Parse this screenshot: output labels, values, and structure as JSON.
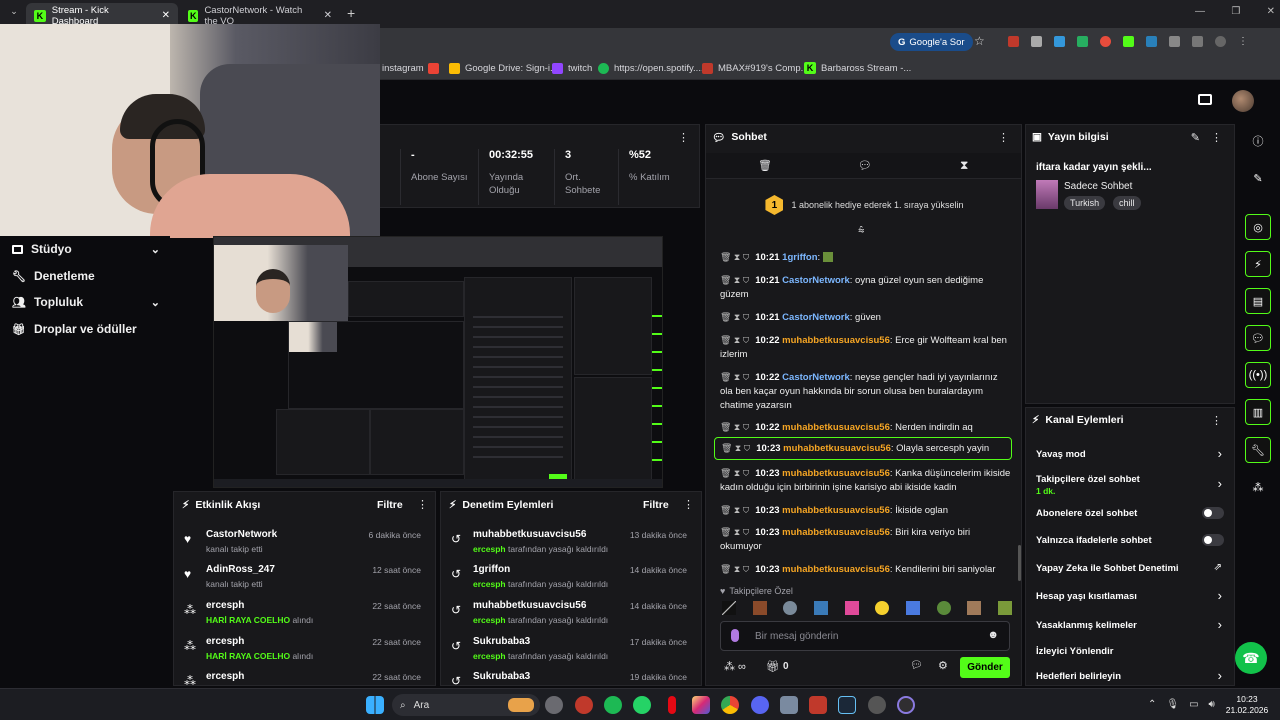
{
  "browser": {
    "tabs": [
      {
        "title": "Stream - Kick Dashboard"
      },
      {
        "title": "CastorNetwork - Watch the VO"
      }
    ],
    "new_tab": "+",
    "omnibox_button": "Google'a Sor",
    "bookmarks": [
      "instagram",
      "Google Drive: Sign-i...",
      "twitch",
      "https://open.spotify....",
      "MBAX#919's Comp...",
      "Barbaross Stream -..."
    ]
  },
  "sidebar": {
    "items": [
      {
        "label": "Stüdyo",
        "icon": "studio-icon",
        "has_chevron": true
      },
      {
        "label": "Denetleme",
        "icon": "wrench-icon",
        "has_chevron": false
      },
      {
        "label": "Topluluk",
        "icon": "community-icon",
        "has_chevron": true
      },
      {
        "label": "Droplar ve ödüller",
        "icon": "gift-icon",
        "has_chevron": false
      }
    ]
  },
  "stats": [
    {
      "value": "-",
      "label": "Abone Sayısı"
    },
    {
      "value": "00:32:55",
      "label": "Yayında Olduğu"
    },
    {
      "value": "3",
      "label": "Ort. Sohbete"
    },
    {
      "value": "%52",
      "label": "% Katılım"
    }
  ],
  "activity": {
    "title": "Etkinlik Akışı",
    "filter": "Filtre",
    "items": [
      {
        "name": "CastorNetwork",
        "sub": "kanalı takip etti",
        "highlight": "",
        "time": "6 dakika önce",
        "icon": "heart-icon"
      },
      {
        "name": "AdinRoss_247",
        "sub": "kanalı takip etti",
        "highlight": "",
        "time": "12 saat önce",
        "icon": "heart-icon"
      },
      {
        "name": "ercesph",
        "sub": "alındı",
        "highlight": "HARİ RAYA COELHO",
        "time": "22 saat önce",
        "icon": "reward-icon"
      },
      {
        "name": "ercesph",
        "sub": "alındı",
        "highlight": "HARİ RAYA COELHO",
        "time": "22 saat önce",
        "icon": "reward-icon"
      },
      {
        "name": "ercesph",
        "sub": "",
        "highlight": "",
        "time": "22 saat önce",
        "icon": "reward-icon"
      }
    ]
  },
  "moderation": {
    "title": "Denetim Eylemleri",
    "filter": "Filtre",
    "items": [
      {
        "name": "muhabbetkusuavcisu56",
        "by": "ercesph",
        "sub": "tarafından yasağı kaldırıldı",
        "time": "13 dakika önce"
      },
      {
        "name": "1griffon",
        "by": "ercesph",
        "sub": "tarafından yasağı kaldırıldı",
        "time": "14 dakika önce"
      },
      {
        "name": "muhabbetkusuavcisu56",
        "by": "ercesph",
        "sub": "tarafından yasağı kaldırıldı",
        "time": "14 dakika önce"
      },
      {
        "name": "Sukrubaba3",
        "by": "ercesph",
        "sub": "tarafından yasağı kaldırıldı",
        "time": "17 dakika önce"
      },
      {
        "name": "Sukrubaba3",
        "by": "",
        "sub": "",
        "time": "19 dakika önce"
      }
    ]
  },
  "chat": {
    "title": "Sohbet",
    "pinned": "1 abonelik hediye ederek 1. sıraya yükselin",
    "pinned_badge": "1",
    "messages": [
      {
        "time": "10:21",
        "user": "1griffon",
        "color": "blue",
        "text": ""
      },
      {
        "time": "10:21",
        "user": "CastorNetwork",
        "color": "blue",
        "text": "oyna güzel oyun sen dediğime güzem"
      },
      {
        "time": "10:21",
        "user": "CastorNetwork",
        "color": "blue",
        "text": "güven"
      },
      {
        "time": "10:22",
        "user": "muhabbetkusuavcisu56",
        "color": "orange",
        "text": "Erce gir Wolfteam kral ben izlerim"
      },
      {
        "time": "10:22",
        "user": "CastorNetwork",
        "color": "blue",
        "text": "neyse gençler hadi iyi yayınlarınız ola ben kaçar oyun hakkında bir sorun olusa ben buralardayım chatime yazarsın"
      },
      {
        "time": "10:22",
        "user": "muhabbetkusuavcisu56",
        "color": "orange",
        "text": "Nerden indirdin aq"
      },
      {
        "time": "10:23",
        "user": "muhabbetkusuavcisu56",
        "color": "orange",
        "text": "Olayla sercesph yayin"
      },
      {
        "time": "10:23",
        "user": "muhabbetkusuavcisu56",
        "color": "orange",
        "text": "Kanka düşüncelerim ikiside kadın olduğu için birbirinin işine karisiyo abi ikiside kadin"
      },
      {
        "time": "10:23",
        "user": "muhabbetkusuavcisu56",
        "color": "orange",
        "text": "İkiside oglan"
      },
      {
        "time": "10:23",
        "user": "muhabbetkusuavcisu56",
        "color": "orange",
        "text": "Biri kira veriyo biri okumuyor"
      },
      {
        "time": "10:23",
        "user": "muhabbetkusuavcisu56",
        "color": "orange",
        "text": "Kendilerini biri saniyolar"
      }
    ],
    "emote_label": "Takipçilere Özel",
    "input_placeholder": "Bir mesaj gönderin",
    "points": "0",
    "send": "Gönder"
  },
  "stream_info": {
    "title": "Yayın bilgisi",
    "stream_title": "iftara kadar yayın şekli...",
    "category": "Sadece Sohbet",
    "tags": [
      "Turkish",
      "chill"
    ]
  },
  "channel_actions": {
    "title": "Kanal Eylemleri",
    "items": [
      {
        "label": "Yavaş mod",
        "sub": "",
        "control": "chevron"
      },
      {
        "label": "Takipçilere özel sohbet",
        "sub": "1 dk.",
        "control": "chevron"
      },
      {
        "label": "Abonelere özel sohbet",
        "sub": "",
        "control": "toggle"
      },
      {
        "label": "Yalnızca ifadelerle sohbet",
        "sub": "",
        "control": "toggle"
      },
      {
        "label": "Yapay Zeka ile Sohbet Denetimi",
        "sub": "",
        "control": "external"
      },
      {
        "label": "Hesap yaşı kısıtlaması",
        "sub": "",
        "control": "chevron"
      },
      {
        "label": "Yasaklanmış kelimeler",
        "sub": "",
        "control": "chevron"
      },
      {
        "label": "İzleyici Yönlendir",
        "sub": "",
        "control": "none"
      },
      {
        "label": "Hedefleri belirleyin",
        "sub": "",
        "control": "chevron"
      }
    ]
  },
  "taskbar": {
    "search": "Ara",
    "time": "10:23",
    "date": "21.02.2026"
  },
  "colors": {
    "kick_green": "#53fc18",
    "panel": "#18181b",
    "bg": "#0b0b0e"
  }
}
